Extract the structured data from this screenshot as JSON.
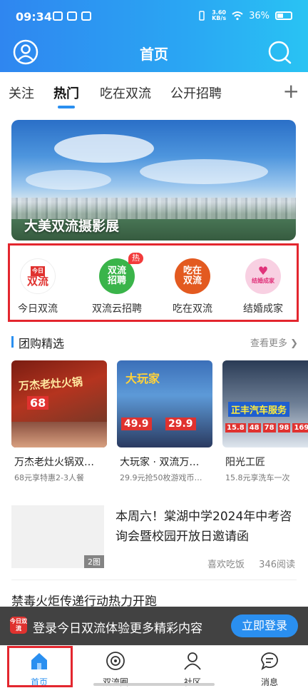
{
  "status_bar": {
    "time": "09:34",
    "net_speed_value": "3.60",
    "net_speed_unit": "KB/s",
    "battery": "36%"
  },
  "header": {
    "title": "首页",
    "left_icon": "user-avatar-icon",
    "right_icon": "search-icon",
    "gradient_start": "#2f86f0",
    "gradient_end": "#29c3f3"
  },
  "tabs": [
    {
      "label": "关注",
      "active": false
    },
    {
      "label": "热门",
      "active": true
    },
    {
      "label": "吃在双流",
      "active": false
    },
    {
      "label": "公开招聘",
      "active": false
    }
  ],
  "tabs_add_label": "+",
  "banner": {
    "caption": "大美双流摄影展"
  },
  "quick_links": [
    {
      "label": "今日双流",
      "icon_text": "双流",
      "icon_top_text": "今日",
      "color": "#e0322f",
      "bg": "#ffffff"
    },
    {
      "label": "双流云招聘",
      "icon_text": "双流招聘",
      "badge": "热",
      "color": "#ffffff",
      "bg": "#3ab44a"
    },
    {
      "label": "吃在双流",
      "icon_text": "吃在双流",
      "color": "#ffffff",
      "bg": "#e35a20"
    },
    {
      "label": "结婚成家",
      "icon_text": "结婚成家",
      "color": "#e0327a",
      "bg": "#f8d0e2"
    }
  ],
  "section": {
    "title": "团购精选",
    "more": "查看更多"
  },
  "group_cards": [
    {
      "title": "万杰老灶火锅双…",
      "sub": "68元享特惠2-3人餐",
      "img_text": "万杰老灶火锅",
      "price": "68"
    },
    {
      "title": "大玩家 · 双流万…",
      "sub": "29.9元抢50枚游戏币…",
      "img_text": "大玩家",
      "price1": "49.9",
      "price2": "29.9"
    },
    {
      "title": "阳光工匠",
      "sub": "15.8元享洗车一次",
      "img_text": "正丰汽车服务",
      "prices": [
        "15.8",
        "48",
        "78",
        "98",
        "169"
      ]
    }
  ],
  "article": {
    "title": "本周六！棠湖中学2024年中考咨询会暨校园开放日邀请函",
    "thumb_badge": "2图",
    "source": "喜欢吃饭",
    "reads": "346阅读"
  },
  "article2": {
    "title": "禁毒火炬传递行动热力开跑"
  },
  "login_bar": {
    "logo_text": "今日双流",
    "text": "登录今日双流体验更多精彩内容",
    "button": "立即登录"
  },
  "bottom_nav": [
    {
      "label": "首页",
      "icon": "home-icon",
      "active": true
    },
    {
      "label": "双流圈",
      "icon": "circle-icon",
      "active": false
    },
    {
      "label": "社区",
      "icon": "community-icon",
      "active": false
    },
    {
      "label": "消息",
      "icon": "message-icon",
      "active": false
    }
  ],
  "accent_color": "#2a8ff0",
  "highlight_color": "#e3262e"
}
